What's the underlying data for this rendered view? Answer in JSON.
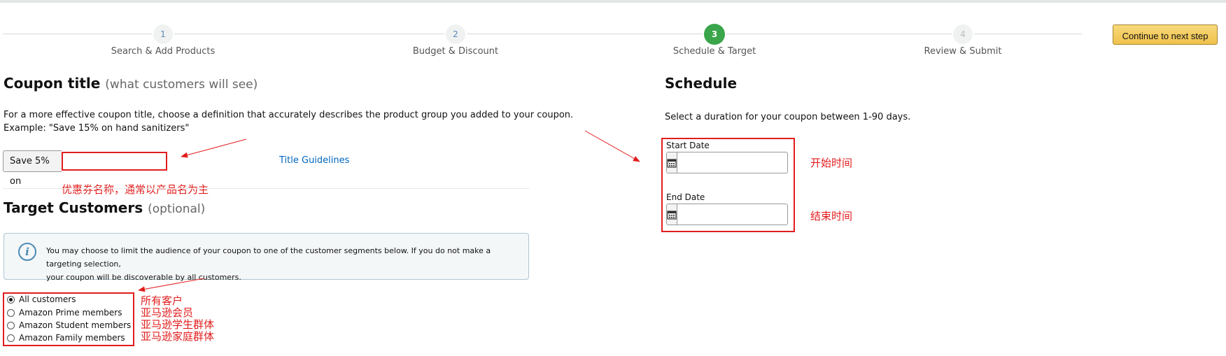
{
  "stepper": {
    "steps": [
      {
        "number": "1",
        "label": "Search & Add Products"
      },
      {
        "number": "2",
        "label": "Budget & Discount"
      },
      {
        "number": "3",
        "label": "Schedule & Target"
      },
      {
        "number": "4",
        "label": "Review & Submit"
      }
    ],
    "continue_label": "Continue to next step"
  },
  "coupon_title": {
    "heading": "Coupon title",
    "subheading": "(what customers will see)",
    "description_line1": "For a more effective coupon title, choose a definition that accurately describes the product group you added to your coupon.",
    "description_line2": "Example: \"Save 15% on hand sanitizers\"",
    "prefix": "Save 5% on",
    "input_value": "",
    "guidelines_link": "Title Guidelines"
  },
  "target": {
    "heading": "Target Customers",
    "subheading": "(optional)",
    "info_line1": "You may choose to limit the audience of your coupon to one of the customer segments below. If you do not make a targeting selection,",
    "info_line2": "your coupon will be discoverable by all customers.",
    "options": [
      {
        "label": "All customers",
        "checked": true
      },
      {
        "label": "Amazon Prime members",
        "checked": false
      },
      {
        "label": "Amazon Student members",
        "checked": false
      },
      {
        "label": "Amazon Family members",
        "checked": false
      }
    ]
  },
  "schedule": {
    "heading": "Schedule",
    "description": "Select a duration for your coupon between 1-90 days.",
    "start_label": "Start Date",
    "start_value": "",
    "end_label": "End Date",
    "end_value": ""
  },
  "annotations": {
    "coupon_title_note": "优惠券名称，通常以产品名为主",
    "audience_notes": [
      "所有客户",
      "亚马逊会员",
      "亚马逊学生群体",
      "亚马逊家庭群体"
    ],
    "start_note": "开始时间",
    "end_note": "结束时间",
    "color": "#e21d1d"
  },
  "colors": {
    "active_step": "#3aa54a",
    "button": "#f0c14b",
    "link": "#0066c0"
  }
}
